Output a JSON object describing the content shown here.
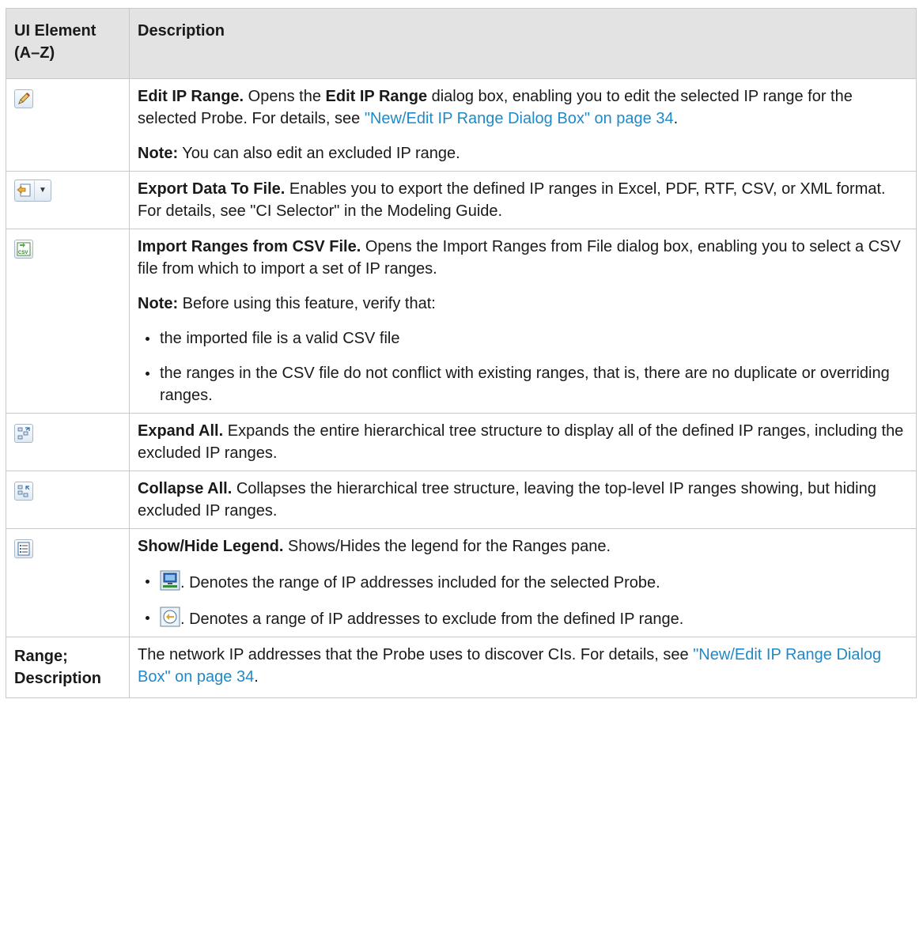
{
  "table": {
    "header": {
      "col1": "UI Element (A–Z)",
      "col2": "Description"
    },
    "rows": [
      {
        "icon": "pencil-edit-icon",
        "title": "Edit IP Range.",
        "text1": " Opens the ",
        "bold1": "Edit IP Range",
        "text2": " dialog box, enabling you to edit the selected IP range for the selected Probe. For details, see ",
        "link": "\"New/Edit IP Range Dialog Box\" on page 34",
        "text3": ".",
        "note_label": "Note:",
        "note_text": " You can also edit an excluded IP range."
      },
      {
        "icon": "export-data-icon",
        "title": "Export Data To File.",
        "text": " Enables you to export the defined IP ranges in Excel, PDF, RTF, CSV, or XML format. For details, see \"CI Selector\" in the Modeling Guide."
      },
      {
        "icon": "import-csv-icon",
        "title": "Import Ranges from CSV File.",
        "text": " Opens the Import Ranges from File dialog box, enabling you to select a CSV file from which to import a set of IP ranges.",
        "note_label": "Note:",
        "note_text": " Before using this feature, verify that:",
        "bullets": [
          "the imported file is a valid CSV file",
          "the ranges in the CSV file do not conflict with existing ranges, that is, there are no duplicate or overriding ranges."
        ]
      },
      {
        "icon": "expand-all-icon",
        "title": "Expand All.",
        "text": " Expands the entire hierarchical tree structure to display all of the defined IP ranges, including the excluded IP ranges."
      },
      {
        "icon": "collapse-all-icon",
        "title": "Collapse All.",
        "text": " Collapses the hierarchical tree structure, leaving the top-level IP ranges showing, but hiding excluded IP ranges."
      },
      {
        "icon": "legend-icon",
        "title": "Show/Hide Legend.",
        "text": " Shows/Hides the legend for the Ranges pane.",
        "legend": [
          {
            "icon": "included-range-icon",
            "text": ". Denotes the range of IP addresses included for the selected Probe."
          },
          {
            "icon": "excluded-range-icon",
            "text": ". Denotes a range of IP addresses to exclude from the defined IP range."
          }
        ]
      },
      {
        "label": "Range; Description",
        "text": "The network IP addresses that the Probe uses to discover CIs. For details, see ",
        "link": "\"New/Edit IP Range Dialog Box\" on page 34",
        "text2": "."
      }
    ]
  },
  "colors": {
    "header_bg": "#e3e3e3",
    "border": "#c9c9c9",
    "link": "#1f8ac7"
  }
}
